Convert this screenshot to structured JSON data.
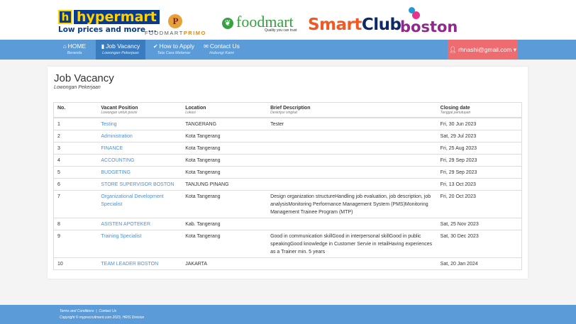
{
  "brands": {
    "hypermart": {
      "name": "hypermart",
      "icon_letter": "h",
      "tagline": "Low prices and more ..."
    },
    "foodmart_primo": {
      "icon_letter": "P",
      "name_a": "FOODMART",
      "name_b": "PRIMO"
    },
    "foodmart": {
      "name": "foodmart",
      "tagline": "Quality you can trust"
    },
    "smartclub": {
      "name_a": "Smart",
      "name_b": "Club"
    },
    "boston": {
      "name": "boston"
    }
  },
  "nav": {
    "items": [
      {
        "icon": "home-icon",
        "label": "HOME",
        "sub": "Beranda"
      },
      {
        "icon": "bookmark-icon",
        "label": "Job Vacancy",
        "sub": "Lowongan Pekerjaan"
      },
      {
        "icon": "check-icon",
        "label": "How to Apply",
        "sub": "Tata Cara Melamar"
      },
      {
        "icon": "envelope-icon",
        "label": "Contact Us",
        "sub": "Hubungi Kami"
      }
    ],
    "user": "rhnashi@gmail.com"
  },
  "page": {
    "title": "Job Vacancy",
    "subtitle": "Lowongan Pekerjaan"
  },
  "table": {
    "headers": [
      {
        "label": "No.",
        "sub": ""
      },
      {
        "label": "Vacant Position",
        "sub": "Lowongan untuk posisi"
      },
      {
        "label": "Location",
        "sub": "Lokasi"
      },
      {
        "label": "Brief Description",
        "sub": "Deskripsi singkat"
      },
      {
        "label": "Closing date",
        "sub": "Tanggal penutupan"
      }
    ],
    "rows": [
      {
        "no": "1",
        "position": "Testing",
        "location": "TANGERANG",
        "description": "Tester",
        "closing": "Fri, 30 Jun 2023"
      },
      {
        "no": "2",
        "position": "Administration",
        "location": "Kota Tangerang",
        "description": "",
        "closing": "Sat, 29 Jul 2023"
      },
      {
        "no": "3",
        "position": "FINANCE",
        "location": "Kota Tangerang",
        "description": "",
        "closing": "Fri, 25 Aug 2023"
      },
      {
        "no": "4",
        "position": "ACCOUNTING",
        "location": "Kota Tangerang",
        "description": "",
        "closing": "Fri, 29 Sep 2023"
      },
      {
        "no": "5",
        "position": "BUDGETING",
        "location": "Kota Tangerang",
        "description": "",
        "closing": "Fri, 29 Sep 2023"
      },
      {
        "no": "6",
        "position": "STORE SUPERVISOR BOSTON",
        "location": "TANJUNG PINANG",
        "description": "",
        "closing": "Fri, 13 Oct 2023"
      },
      {
        "no": "7",
        "position": "Organizational Development Specialist",
        "location": "Kota Tangerang",
        "description": "Design organization structureHandling job evaluation, job description, job analysisMonitoring Performance Management System (PMS)Monitoring Management Trainee Program (MTP)",
        "closing": "Fri, 20 Oct 2023"
      },
      {
        "no": "8",
        "position": "ASISTEN APOTEKER",
        "location": "Kab. Tangerang",
        "description": "",
        "closing": "Sat, 25 Nov 2023"
      },
      {
        "no": "9",
        "position": "Training Specialist",
        "location": "Kota Tangerang",
        "description": "Good in communication skillGood in interpersonal skillGood in public speakingGood knowledge in Customer Servie in retailHaving experiences as a Trainer min. 5 years",
        "closing": "Sat, 30 Dec 2023"
      },
      {
        "no": "10",
        "position": "TEAM LEADER BOSTON",
        "location": "JAKARTA",
        "description": "",
        "closing": "Sat, 20 Jan 2024"
      }
    ]
  },
  "footer": {
    "terms": "Terms and Conditions",
    "separator": "|",
    "contact": "Contact Us",
    "copyright": "Copyright © myprecruitment.com 2023, HRIS Division"
  },
  "colors": {
    "navbar": "#5a9bd8",
    "nav_active": "#3a7cc0",
    "user_button": "#ee6b6f",
    "link": "#4a90d9"
  }
}
